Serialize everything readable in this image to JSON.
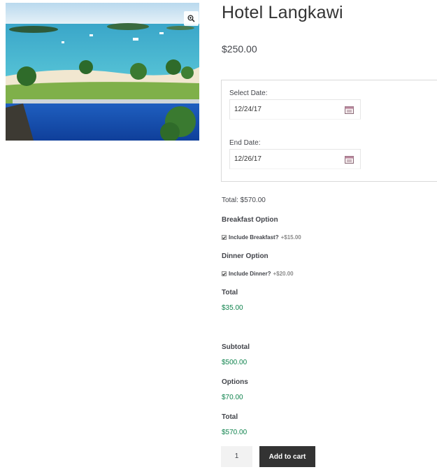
{
  "product": {
    "image_alt": "resort pool overlooking sea",
    "zoom_icon": "magnifier-zoom-icon",
    "title": "Hotel Langkawi",
    "price": "$250.00"
  },
  "booking": {
    "start_label": "Select Date:",
    "start_value": "12/24/17",
    "end_label": "End Date:",
    "end_value": "12/26/17",
    "calendar_icon": "calendar-icon",
    "total_text": "Total: $570.00"
  },
  "options": {
    "breakfast_heading": "Breakfast Option",
    "breakfast_label": "Include Breakfast?",
    "breakfast_price": "+$15.00",
    "breakfast_checked": true,
    "dinner_heading": "Dinner Option",
    "dinner_label": "Include Dinner?",
    "dinner_price": "+$20.00",
    "dinner_checked": true,
    "total_heading": "Total",
    "total_value": "$35.00"
  },
  "summary": {
    "subtotal_heading": "Subtotal",
    "subtotal_value": "$500.00",
    "options_heading": "Options",
    "options_value": "$70.00",
    "total_heading": "Total",
    "total_value": "$570.00"
  },
  "cart": {
    "quantity": "1",
    "add_label": "Add to cart"
  },
  "colors": {
    "accent_green": "#0f834d",
    "button_dark": "#333333"
  }
}
